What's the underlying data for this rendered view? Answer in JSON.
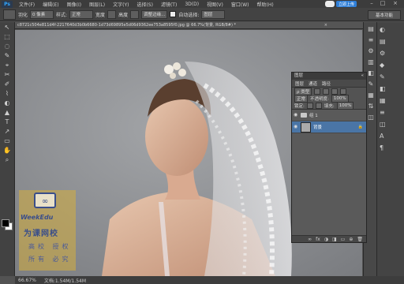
{
  "app": {
    "logo": "Ps"
  },
  "menu": [
    "文件(F)",
    "编辑(E)",
    "图像(I)",
    "图层(L)",
    "文字(Y)",
    "选择(S)",
    "滤镜(T)",
    "3D(D)",
    "视图(V)",
    "窗口(W)",
    "帮助(H)"
  ],
  "cloud_button": "立即上传",
  "window_controls": {
    "minimize": "–",
    "maximize": "□",
    "close": "×"
  },
  "options": {
    "size_label": "羽化",
    "size_value": "0 像素",
    "style_label": "样式:",
    "style_value": "正常",
    "width_label": "宽度",
    "height_label": "高度",
    "refine_label": "调整边缘...",
    "auto_select_label": "自动选择:",
    "auto_select_value": "图层"
  },
  "workspace": "基本功能",
  "document": {
    "tab_title": "c8721c504e811d4f-2217640d3b0b6680-1d73d69895e5d06d9362ee753a8595f0.jpg @ 66.7%(背景, RGB/8#) *",
    "close": "×"
  },
  "status": {
    "zoom": "66.67%",
    "doc_info": "文档:1.54M/1.54M"
  },
  "tools": [
    "↖",
    "⬚",
    "◌",
    "✎",
    "⌖",
    "✂",
    "✐",
    "⌇",
    "◐",
    "▲",
    "T",
    "↗",
    "▭",
    "✋",
    "⌕"
  ],
  "midstrip_tools": [
    "▤",
    "≡",
    "⚙",
    "▥",
    "◧",
    "✎",
    "▦",
    "⇅",
    "◫"
  ],
  "dock": [
    "◐",
    "▤",
    "⚙",
    "◆",
    "✎",
    "◧",
    "▦",
    "≡",
    "◫",
    "A",
    "¶"
  ],
  "layers_panel": {
    "title": "图层",
    "close": "«",
    "tabs": [
      "图层",
      "通道",
      "路径"
    ],
    "kind_label": "ρ 类型",
    "blend_mode": "正常",
    "opacity_label": "不透明度:",
    "opacity_value": "100%",
    "lock_label": "锁定:",
    "fill_label": "填充:",
    "fill_value": "100%",
    "layers": [
      {
        "name": "组 1",
        "type": "group",
        "active": false
      },
      {
        "name": "背景",
        "type": "image",
        "active": true
      }
    ],
    "bottom_icons": [
      "∞",
      "fx",
      "◑",
      "◨",
      "▭",
      "⊕",
      "🗑"
    ]
  },
  "watermark": {
    "logo_text": "WeekEdu",
    "title": "为课网校",
    "line1": "高校 授权",
    "line2": "所有 必究"
  }
}
